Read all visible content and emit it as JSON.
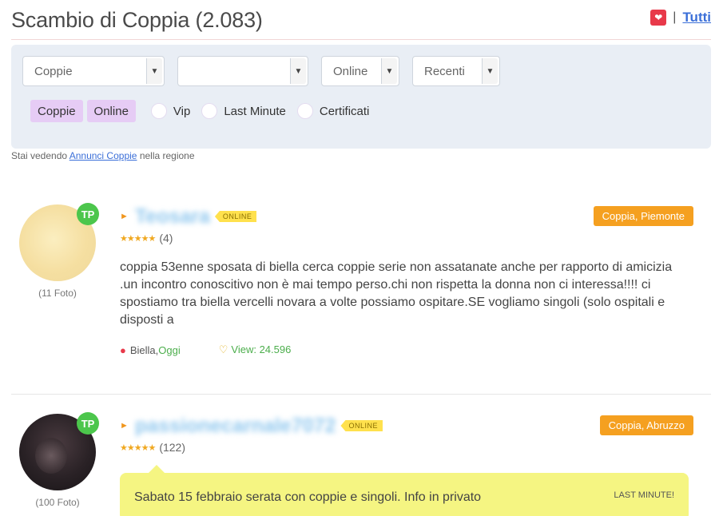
{
  "header": {
    "title": "Scambio di Coppia (2.083)",
    "separator": "|",
    "all_link": "Tutti",
    "heart_icon": "heart-icon"
  },
  "filters": {
    "select_type": "Coppie",
    "select_region": "",
    "select_status": "Online",
    "select_sort": "Recenti",
    "chips": [
      "Coppie",
      "Online"
    ],
    "radios": [
      "Vip",
      "Last Minute",
      "Certificati"
    ]
  },
  "info_line": {
    "prefix": "Stai vedendo",
    "link": "Annunci Coppie",
    "suffix": "nella regione"
  },
  "listings": [
    {
      "username": "Teosara",
      "online_tag": "ONLINE",
      "badge": "TP",
      "photos": "(11 Foto)",
      "region": "Coppia, Piemonte",
      "rating_count": "(4)",
      "description": "coppia 53enne sposata di biella cerca coppie serie non assatanate anche per rapporto di amicizia .un incontro conoscitivo non è mai tempo perso.chi non rispetta la donna non ci interessa!!!! ci spostiamo tra biella vercelli novara a volte possiamo ospitare.SE vogliamo singoli (solo ospitali e disposti a",
      "city": "Biella",
      "city_sep": " , ",
      "when": "Oggi",
      "views": "View: 24.596"
    },
    {
      "username": "passionecarnale7072",
      "online_tag": "ONLINE",
      "badge": "TP",
      "photos": "(100 Foto)",
      "region": "Coppia, Abruzzo",
      "rating_count": "(122)",
      "last_minute_text": "Sabato 15 febbraio serata con coppie e singoli. Info in privato",
      "last_minute_label": "LAST MINUTE!"
    }
  ],
  "colors": {
    "accent_orange": "#f5a020",
    "online_yellow": "#ffe14d",
    "chip_purple": "#e6ccf5",
    "badge_green": "#4cc64c",
    "link_blue": "#3b6fd8",
    "lastminute_bg": "#f5f582"
  }
}
